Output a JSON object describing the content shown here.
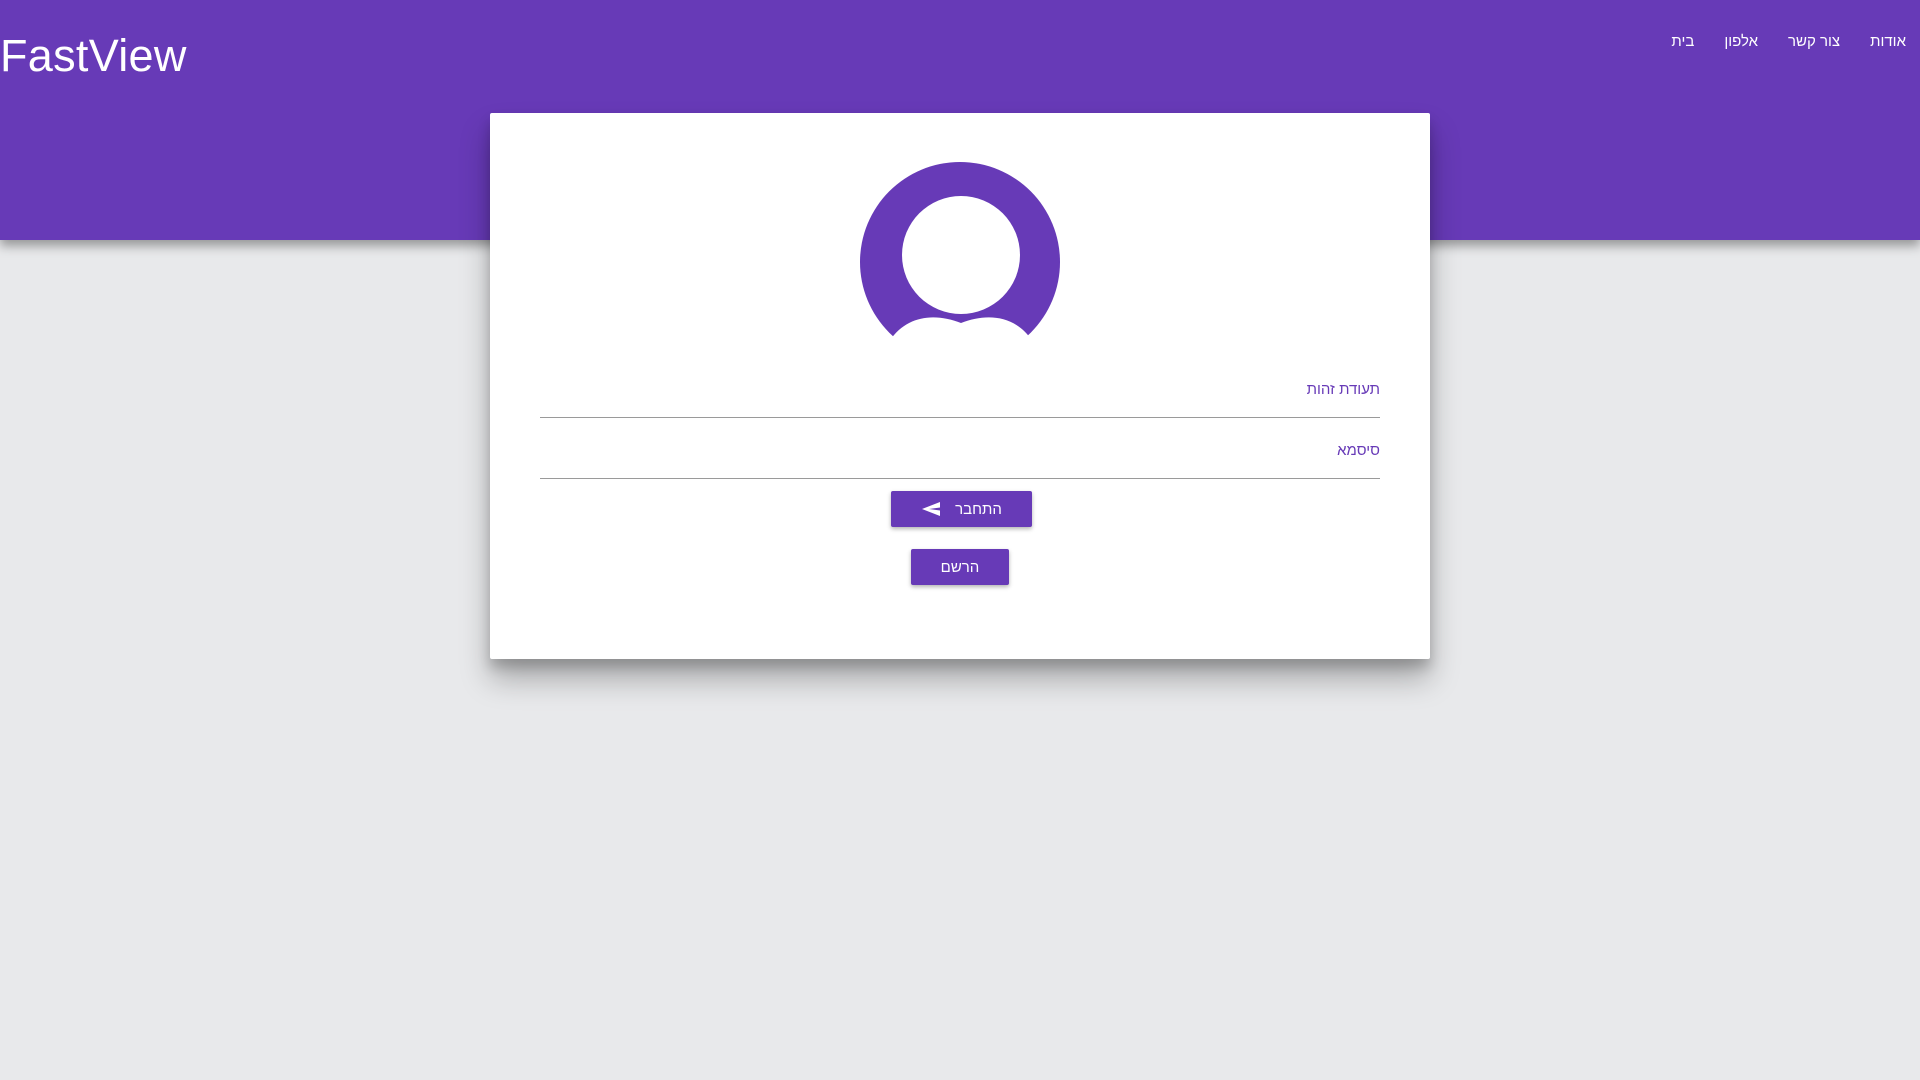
{
  "header": {
    "brand": "FastView",
    "nav": [
      {
        "label": "בית"
      },
      {
        "label": "אלפון"
      },
      {
        "label": "צור קשר"
      },
      {
        "label": "אודות"
      }
    ],
    "color": "#673ab7"
  },
  "login": {
    "avatar_icon": "account-circle-icon",
    "id_label": "תעודת זהות",
    "id_value": "",
    "password_label": "סיסמא",
    "password_value": "",
    "login_button": "התחבר",
    "login_icon": "send-icon",
    "register_button": "הרשם"
  },
  "colors": {
    "accent": "#673ab7",
    "background": "#e8e9eb",
    "card": "#ffffff"
  }
}
